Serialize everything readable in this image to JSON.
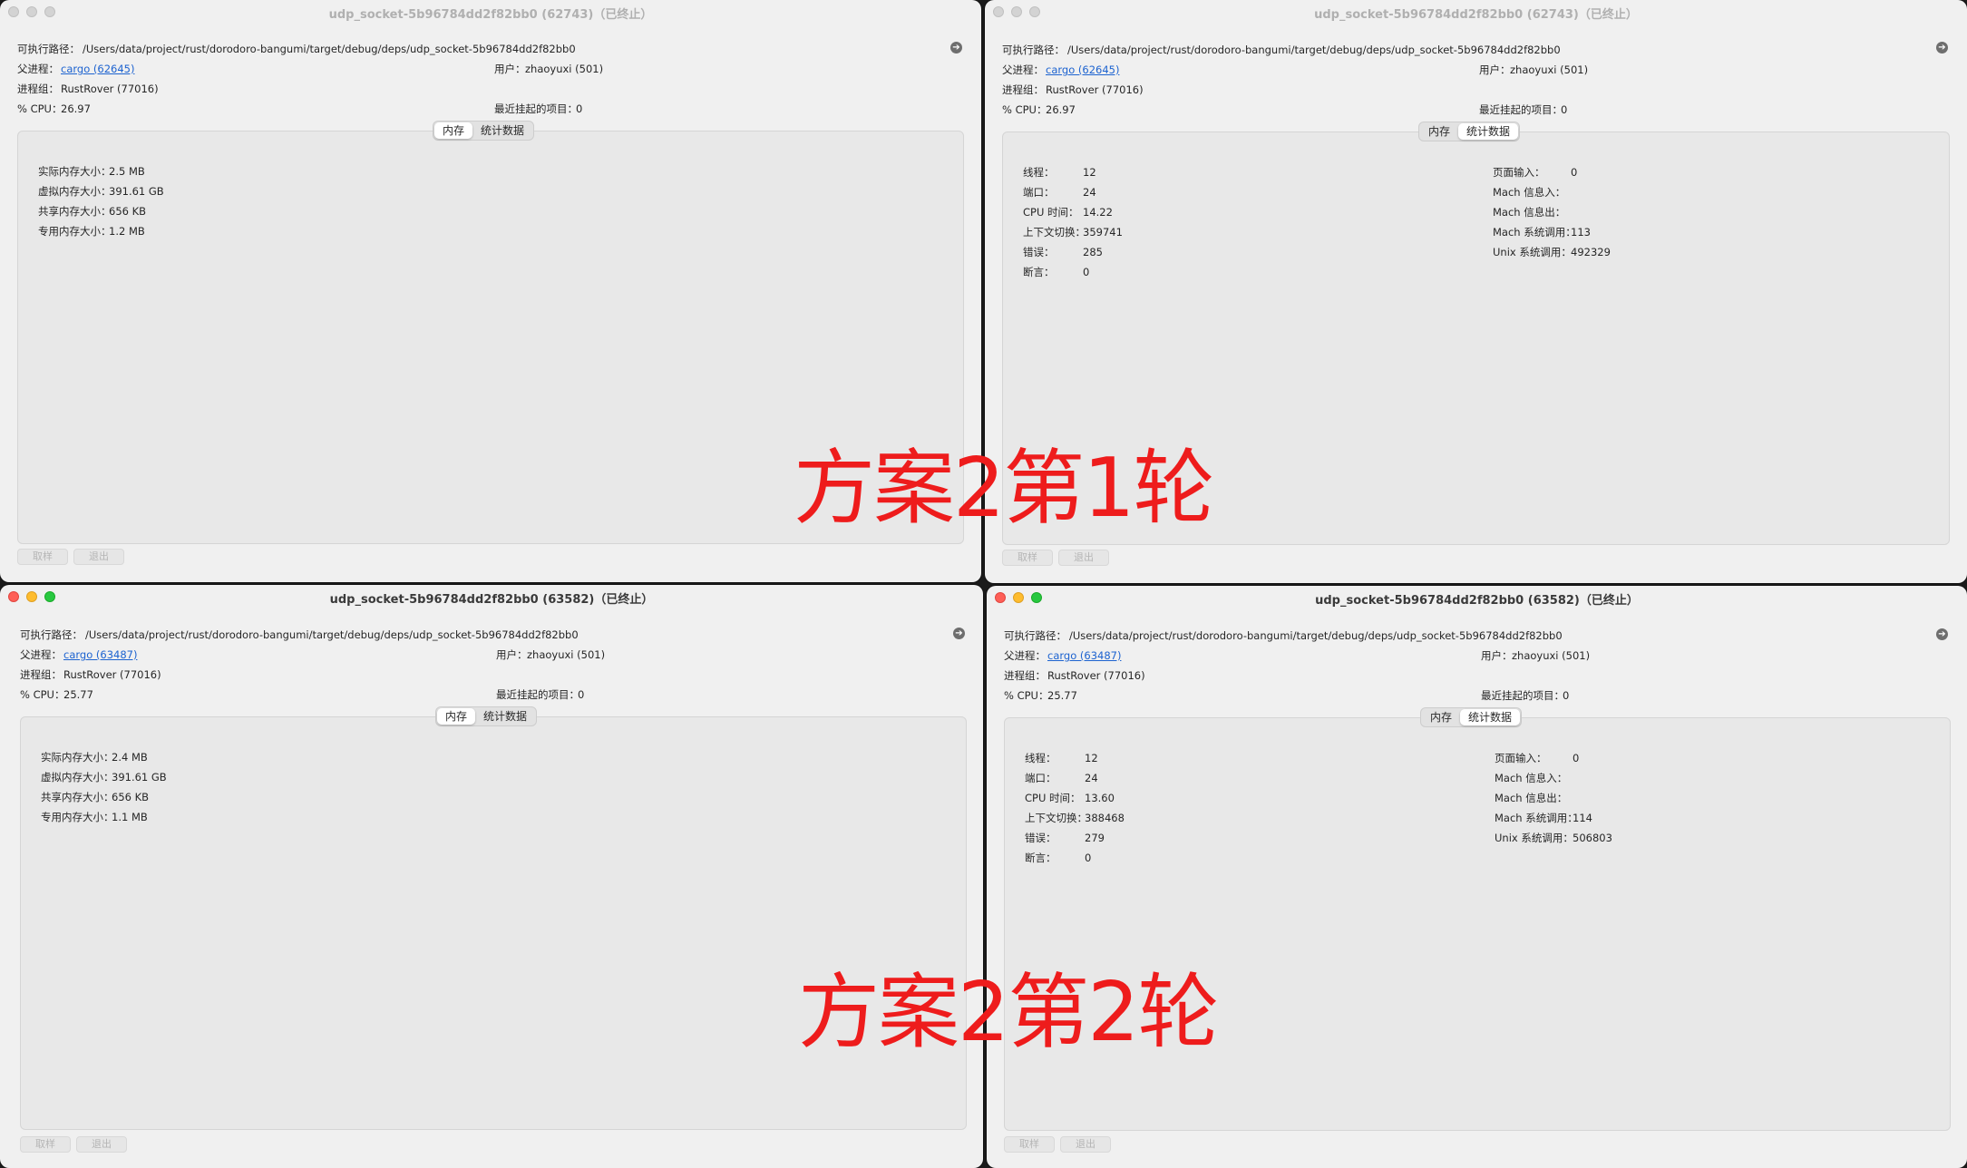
{
  "overlays": [
    "方案2第1轮",
    "方案2第2轮"
  ],
  "labels": {
    "exec_path": "可执行路径：",
    "parent": "父进程：",
    "group": "进程组：",
    "cpu": "% CPU：",
    "user": "用户：",
    "recent": "最近挂起的项目：",
    "tab_memory": "内存",
    "tab_stats": "统计数据",
    "sample": "取样",
    "quit": "退出"
  },
  "windows": [
    {
      "title": "udp_socket-5b96784dd2f82bb0 (62743)（已终止）",
      "state": "inactive",
      "exec_path": "/Users/data/project/rust/dorodoro-bangumi/target/debug/deps/udp_socket-5b96784dd2f82bb0",
      "parent": "cargo (62645)",
      "group": "RustRover (77016)",
      "cpu": "26.97",
      "user": "zhaoyuxi (501)",
      "recent": "0",
      "selected_tab": "memory",
      "memory": [
        {
          "label": "实际内存大小：",
          "value": "2.5 MB"
        },
        {
          "label": "虚拟内存大小：",
          "value": "391.61 GB"
        },
        {
          "label": "共享内存大小：",
          "value": "656 KB"
        },
        {
          "label": "专用内存大小：",
          "value": "1.2 MB"
        }
      ]
    },
    {
      "title": "udp_socket-5b96784dd2f82bb0 (62743)（已终止）",
      "state": "inactive",
      "exec_path": "/Users/data/project/rust/dorodoro-bangumi/target/debug/deps/udp_socket-5b96784dd2f82bb0",
      "parent": "cargo (62645)",
      "group": "RustRover (77016)",
      "cpu": "26.97",
      "user": "zhaoyuxi (501)",
      "recent": "0",
      "selected_tab": "stats",
      "stats_left": [
        {
          "label": "线程：",
          "value": "12"
        },
        {
          "label": "端口：",
          "value": "24"
        },
        {
          "label": "CPU 时间：",
          "value": "14.22"
        },
        {
          "label": "上下文切换：",
          "value": "359741"
        },
        {
          "label": "错误：",
          "value": "285"
        },
        {
          "label": "断言：",
          "value": "0"
        }
      ],
      "stats_right": [
        {
          "label": "页面输入：",
          "value": "0"
        },
        {
          "label": "Mach 信息入：",
          "value": ""
        },
        {
          "label": "Mach 信息出：",
          "value": ""
        },
        {
          "label": "Mach 系统调用：",
          "value": "113"
        },
        {
          "label": "Unix 系统调用：",
          "value": "492329"
        }
      ]
    },
    {
      "title": "udp_socket-5b96784dd2f82bb0 (63582)（已终止）",
      "state": "active",
      "exec_path": "/Users/data/project/rust/dorodoro-bangumi/target/debug/deps/udp_socket-5b96784dd2f82bb0",
      "parent": "cargo (63487)",
      "group": "RustRover (77016)",
      "cpu": "25.77",
      "user": "zhaoyuxi (501)",
      "recent": "0",
      "selected_tab": "memory",
      "memory": [
        {
          "label": "实际内存大小：",
          "value": "2.4 MB"
        },
        {
          "label": "虚拟内存大小：",
          "value": "391.61 GB"
        },
        {
          "label": "共享内存大小：",
          "value": "656 KB"
        },
        {
          "label": "专用内存大小：",
          "value": "1.1 MB"
        }
      ]
    },
    {
      "title": "udp_socket-5b96784dd2f82bb0 (63582)（已终止）",
      "state": "active",
      "exec_path": "/Users/data/project/rust/dorodoro-bangumi/target/debug/deps/udp_socket-5b96784dd2f82bb0",
      "parent": "cargo (63487)",
      "group": "RustRover (77016)",
      "cpu": "25.77",
      "user": "zhaoyuxi (501)",
      "recent": "0",
      "selected_tab": "stats",
      "stats_left": [
        {
          "label": "线程：",
          "value": "12"
        },
        {
          "label": "端口：",
          "value": "24"
        },
        {
          "label": "CPU 时间：",
          "value": "13.60"
        },
        {
          "label": "上下文切换：",
          "value": "388468"
        },
        {
          "label": "错误：",
          "value": "279"
        },
        {
          "label": "断言：",
          "value": "0"
        }
      ],
      "stats_right": [
        {
          "label": "页面输入：",
          "value": "0"
        },
        {
          "label": "Mach 信息入：",
          "value": ""
        },
        {
          "label": "Mach 信息出：",
          "value": ""
        },
        {
          "label": "Mach 系统调用：",
          "value": "114"
        },
        {
          "label": "Unix 系统调用：",
          "value": "506803"
        }
      ]
    }
  ]
}
